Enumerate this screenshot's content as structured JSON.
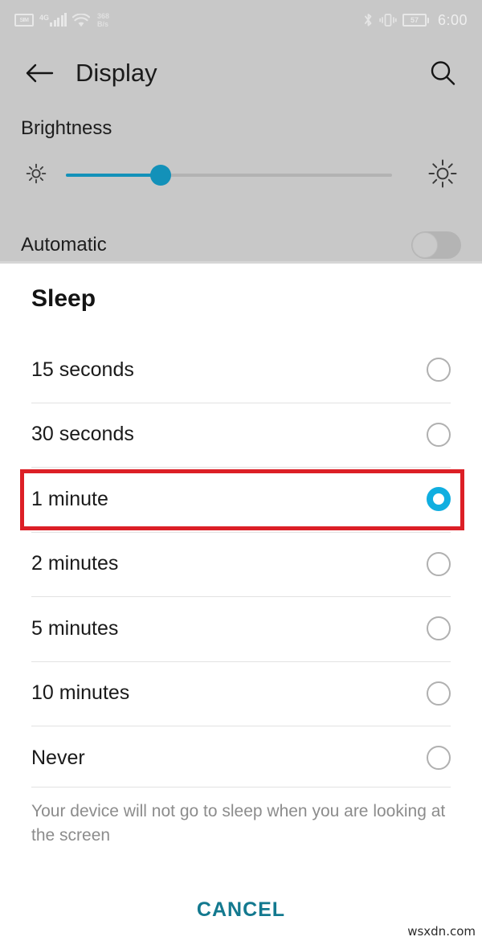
{
  "status_bar": {
    "sim_label": "SIM",
    "network_type": "4G",
    "signal_bars": 5,
    "wifi_icon": "wifi-icon",
    "data_rate_value": "368",
    "data_rate_unit": "B/s",
    "bluetooth_icon": "bluetooth-icon",
    "vibrate_icon": "vibrate-icon",
    "battery_percent": "57",
    "time": "6:00"
  },
  "app_bar": {
    "back_icon": "back-arrow-icon",
    "title": "Display",
    "search_icon": "search-icon"
  },
  "display_settings": {
    "brightness_label": "Brightness",
    "brightness_percent": 29,
    "brightness_low_icon": "brightness-low-icon",
    "brightness_high_icon": "brightness-high-icon",
    "automatic_label": "Automatic",
    "automatic_enabled": false
  },
  "dialog": {
    "title": "Sleep",
    "selected_value": "1 minute",
    "options": [
      {
        "label": "15 seconds",
        "selected": false
      },
      {
        "label": "30 seconds",
        "selected": false
      },
      {
        "label": "1 minute",
        "selected": true
      },
      {
        "label": "2 minutes",
        "selected": false
      },
      {
        "label": "5 minutes",
        "selected": false
      },
      {
        "label": "10 minutes",
        "selected": false
      },
      {
        "label": "Never",
        "selected": false
      }
    ],
    "note": "Your device will not go to sleep when you are looking at the screen",
    "cancel_label": "CANCEL"
  },
  "annotation": {
    "highlight_target": "1 minute",
    "color": "#dc1f26"
  },
  "watermark": "wsxdn.com",
  "colors": {
    "accent_teal": "#13798f",
    "radio_selected": "#10aee0",
    "slider_fill": "#1391b9",
    "background_dim": "#c8c8c8",
    "sheet": "#ffffff"
  }
}
